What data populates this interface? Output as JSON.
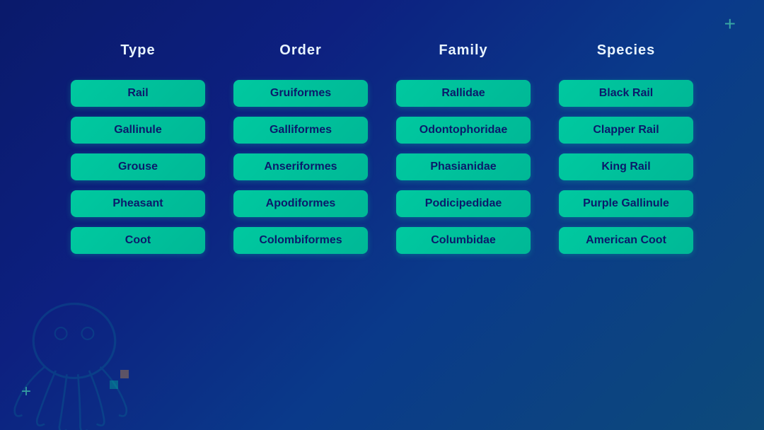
{
  "header": {
    "columns": [
      {
        "label": "Type",
        "key": "type"
      },
      {
        "label": "Order",
        "key": "order"
      },
      {
        "label": "Family",
        "key": "family"
      },
      {
        "label": "Species",
        "key": "species"
      }
    ]
  },
  "rows": [
    {
      "type": "Rail",
      "order": "Gruiformes",
      "family": "Rallidae",
      "species": "Black Rail"
    },
    {
      "type": "Gallinule",
      "order": "Galliformes",
      "family": "Odontophoridae",
      "species": "Clapper Rail"
    },
    {
      "type": "Grouse",
      "order": "Anseriformes",
      "family": "Phasianidae",
      "species": "King Rail"
    },
    {
      "type": "Pheasant",
      "order": "Apodiformes",
      "family": "Podicipedidae",
      "species": "Purple Gallinule"
    },
    {
      "type": "Coot",
      "order": "Colombiformes",
      "family": "Columbidae",
      "species": "American Coot"
    }
  ],
  "decorations": {
    "plus_top_right": "+",
    "plus_bottom_left": "+"
  }
}
